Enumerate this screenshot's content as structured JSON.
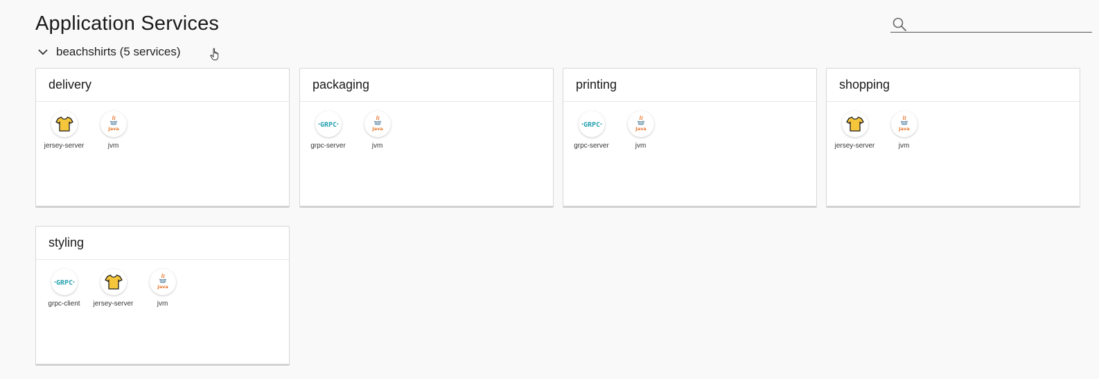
{
  "header": {
    "title": "Application Services"
  },
  "search": {
    "value": "",
    "placeholder": "",
    "icon": "search-icon"
  },
  "group": {
    "label": "beachshirts (5 services)",
    "expanded": true
  },
  "cards": [
    {
      "title": "delivery",
      "components": [
        {
          "label": "jersey-server",
          "icon": "tshirt-icon"
        },
        {
          "label": "jvm",
          "icon": "java-icon"
        }
      ]
    },
    {
      "title": "packaging",
      "components": [
        {
          "label": "grpc-server",
          "icon": "grpc-icon"
        },
        {
          "label": "jvm",
          "icon": "java-icon"
        }
      ]
    },
    {
      "title": "printing",
      "components": [
        {
          "label": "grpc-server",
          "icon": "grpc-icon"
        },
        {
          "label": "jvm",
          "icon": "java-icon"
        }
      ]
    },
    {
      "title": "shopping",
      "components": [
        {
          "label": "jersey-server",
          "icon": "tshirt-icon"
        },
        {
          "label": "jvm",
          "icon": "java-icon"
        }
      ]
    },
    {
      "title": "styling",
      "components": [
        {
          "label": "grpc-client",
          "icon": "grpc-icon"
        },
        {
          "label": "jersey-server",
          "icon": "tshirt-icon"
        },
        {
          "label": "jvm",
          "icon": "java-icon"
        }
      ]
    }
  ],
  "colors": {
    "background": "#f9f9f9",
    "card_background": "#ffffff",
    "tshirt_fill": "#f5c63b",
    "grpc_teal": "#2ba3b0",
    "java_orange": "#e8762d",
    "java_blue": "#5382a1"
  }
}
